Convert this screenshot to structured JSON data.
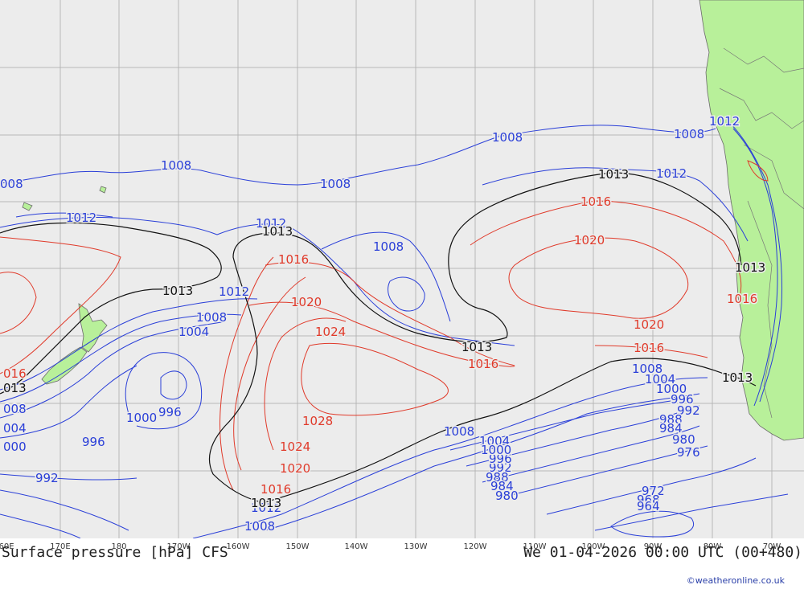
{
  "header": {
    "title": "Surface pressure [hPa] CFS",
    "valid_time": "We 01-04-2026 00:00 UTC (00+480)",
    "credit": "©weatheronline.co.uk"
  },
  "lon_labels": [
    "60E",
    "170E",
    "180",
    "170W",
    "160W",
    "150W",
    "140W",
    "130W",
    "120W",
    "110W",
    "100W",
    "90W",
    "80W",
    "70W"
  ],
  "colors": {
    "ocean": "#ececec",
    "land": "#b8f09a",
    "low_isobar": "#2a3fd8",
    "high_isobar": "#e03a2a",
    "standard_isobar": "#111111",
    "graticule": "#b7b7b7"
  },
  "isobar_labels": {
    "blue": [
      "1008",
      "1008",
      "1008",
      "1008",
      "008",
      "1012",
      "1012",
      "1012",
      "1012",
      "1012",
      "1008",
      "1004",
      "996",
      "1000",
      "996",
      "1008",
      "1004",
      "1008",
      "1004",
      "1000",
      "996",
      "992",
      "988",
      "984",
      "980",
      "976",
      "972",
      "968",
      "964",
      "992",
      "996",
      "1000",
      "1004",
      "1008",
      "008",
      "004",
      "000",
      "996",
      "992",
      "1008",
      "1012",
      "1000",
      "996",
      "992",
      "988",
      "984",
      "980"
    ],
    "red": [
      "1016",
      "1020",
      "1024",
      "1028",
      "1024",
      "1020",
      "1016",
      "1016",
      "1020",
      "1016",
      "1020",
      "1016",
      "1016",
      "016"
    ],
    "black": [
      "1013",
      "1013",
      "1013",
      "1013",
      "1013",
      "1013",
      "013",
      "1013",
      "1013",
      "1013"
    ]
  }
}
